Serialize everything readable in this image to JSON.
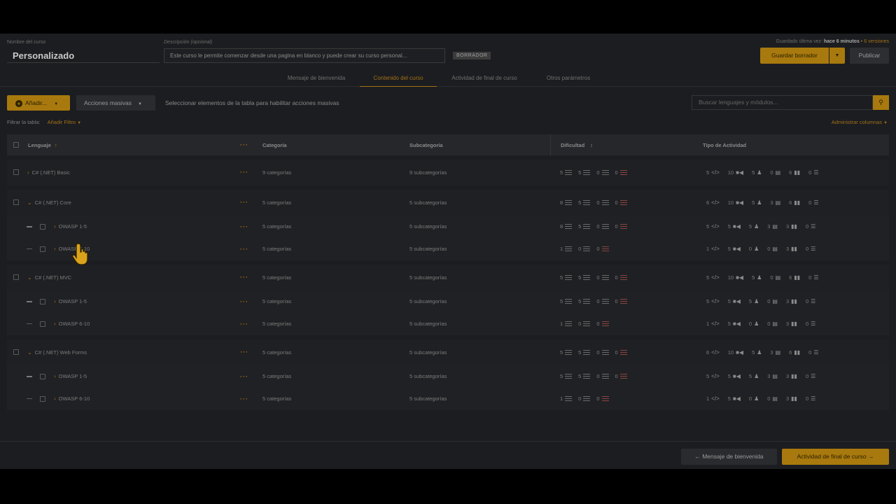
{
  "header": {
    "course_name_label": "Nombre del curso",
    "course_name": "Personalizado",
    "description_label": "Descripción (opcional)",
    "description": "Este curso le permite comenzar desde una pagina en blanco y puede crear su curso personal...",
    "draft_badge": "BORRADOR",
    "saved_prefix": "Guardado última vez:",
    "saved_time": "hace 6 minutos",
    "saved_sep": "•",
    "versions": "6 versiones",
    "save_draft": "Guardar borrador",
    "publish": "Publicar"
  },
  "tabs": [
    {
      "label": "Mensaje de bienvenida",
      "active": false
    },
    {
      "label": "Contenido del curso",
      "active": true
    },
    {
      "label": "Actividad de final de curso",
      "active": false
    },
    {
      "label": "Otros parámetros",
      "active": false
    }
  ],
  "toolbar": {
    "add": "Añadir...",
    "mass_actions": "Acciones masivas",
    "hint": "Seleccionar elementos de la tabla para habilitar acciones masivas",
    "search_placeholder": "Buscar lenguajes y módulos...",
    "filter_label": "Filtrar la tabla:",
    "add_filter": "Añadir Filtro",
    "manage_columns": "Administrar columnas"
  },
  "table": {
    "columns": {
      "language": "Lenguaje",
      "category": "Categoría",
      "subcategory": "Subcategoría",
      "difficulty": "Dificultad",
      "activity_type": "Tipo de Actividad"
    },
    "rows": [
      {
        "level": 0,
        "expanded": false,
        "name": "C# (.NET) Basic",
        "cat": "9 categorías",
        "sub": "9 subcategorías",
        "diff": [
          "5",
          "5",
          "0",
          "0"
        ],
        "act": [
          "5",
          "10",
          "5",
          "0",
          "6",
          "0"
        ]
      },
      {
        "level": 0,
        "expanded": true,
        "name": "C# (.NET) Core",
        "cat": "5 categorías",
        "sub": "5 subcategorías",
        "diff": [
          "8",
          "5",
          "0",
          "0"
        ],
        "act": [
          "6",
          "10",
          "5",
          "3",
          "6",
          "0"
        ]
      },
      {
        "level": 1,
        "expanded": false,
        "name": "OWASP 1-5",
        "cat": "5 categorías",
        "sub": "5 subcategorías",
        "diff": [
          "8",
          "5",
          "0",
          "0"
        ],
        "act": [
          "5",
          "5",
          "5",
          "3",
          "3",
          "0"
        ]
      },
      {
        "level": 1,
        "expanded": false,
        "name": "OWASP 6-10",
        "cat": "5 categorías",
        "sub": "5 subcategorías",
        "diff": [
          "1",
          "0",
          "0"
        ],
        "act": [
          "1",
          "5",
          "0",
          "0",
          "3",
          "0"
        ]
      },
      {
        "level": 0,
        "expanded": true,
        "name": "C# (.NET) MVC",
        "cat": "5 categorías",
        "sub": "5 subcategorías",
        "diff": [
          "5",
          "5",
          "0",
          "0"
        ],
        "act": [
          "5",
          "10",
          "5",
          "0",
          "6",
          "0"
        ]
      },
      {
        "level": 1,
        "expanded": false,
        "name": "OWASP 1-5",
        "cat": "5 categorías",
        "sub": "5 subcategorías",
        "diff": [
          "5",
          "5",
          "0",
          "0"
        ],
        "act": [
          "5",
          "5",
          "5",
          "0",
          "3",
          "0"
        ]
      },
      {
        "level": 1,
        "expanded": false,
        "name": "OWASP 6-10",
        "cat": "5 categorías",
        "sub": "5 subcategorías",
        "diff": [
          "1",
          "0",
          "0"
        ],
        "act": [
          "1",
          "5",
          "0",
          "0",
          "3",
          "0"
        ]
      },
      {
        "level": 0,
        "expanded": true,
        "name": "C# (.NET) Web Forms",
        "cat": "5 categorías",
        "sub": "5 subcategorías",
        "diff": [
          "5",
          "5",
          "0",
          "0"
        ],
        "act": [
          "6",
          "10",
          "5",
          "3",
          "6",
          "0"
        ]
      },
      {
        "level": 1,
        "expanded": false,
        "name": "OWASP 1-5",
        "cat": "5 categorías",
        "sub": "5 subcategorías",
        "diff": [
          "5",
          "5",
          "0",
          "0"
        ],
        "act": [
          "5",
          "5",
          "5",
          "3",
          "3",
          "0"
        ]
      },
      {
        "level": 1,
        "expanded": false,
        "name": "OWASP 6-10",
        "cat": "5 categorías",
        "sub": "5 subcategorías",
        "diff": [
          "1",
          "0",
          "0"
        ],
        "act": [
          "1",
          "5",
          "0",
          "0",
          "3",
          "0"
        ]
      }
    ]
  },
  "footer": {
    "prev": "Mensaje de bienvenida",
    "next": "Actividad de final de curso"
  },
  "colors": {
    "accent": "#a8790e",
    "bg": "#1c1d20"
  }
}
